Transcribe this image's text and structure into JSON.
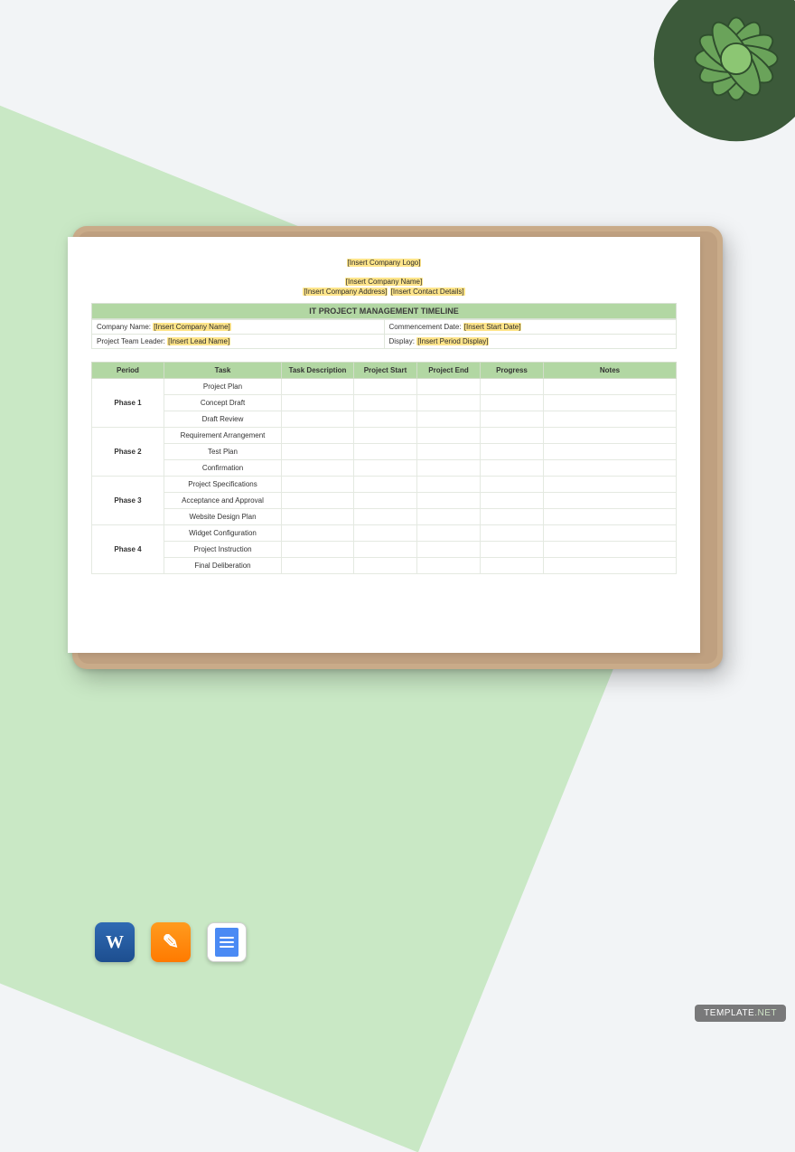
{
  "placeholders": {
    "logo": "[Insert Company Logo]",
    "company_name_hdr": "[Insert Company Name]",
    "address": "[Insert Company Address]",
    "contact": "[Insert Contact Details]"
  },
  "title": "IT PROJECT MANAGEMENT TIMELINE",
  "info": {
    "company_label": "Company Name:",
    "company_ph": "[Insert Company Name]",
    "commence_label": "Commencement Date:",
    "commence_ph": "[Insert Start Date]",
    "lead_label": "Project Team Leader:",
    "lead_ph": "[Insert Lead Name]",
    "display_label": "Display:",
    "display_ph": "[Insert Period Display]"
  },
  "columns": {
    "period": "Period",
    "task": "Task",
    "desc": "Task Description",
    "start": "Project Start",
    "end": "Project End",
    "progress": "Progress",
    "notes": "Notes"
  },
  "phases": [
    {
      "name": "Phase 1",
      "tasks": [
        "Project Plan",
        "Concept Draft",
        "Draft Review"
      ]
    },
    {
      "name": "Phase 2",
      "tasks": [
        "Requirement Arrangement",
        "Test Plan",
        "Confirmation"
      ]
    },
    {
      "name": "Phase 3",
      "tasks": [
        "Project Specifications",
        "Acceptance and Approval",
        "Website Design Plan"
      ]
    },
    {
      "name": "Phase 4",
      "tasks": [
        "Widget Configuration",
        "Project Instruction",
        "Final Deliberation"
      ]
    }
  ],
  "apps": {
    "word_letter": "W",
    "pages_letter": "✎"
  },
  "watermark": {
    "brand": "TEMPLATE",
    "suffix": ".NET"
  }
}
